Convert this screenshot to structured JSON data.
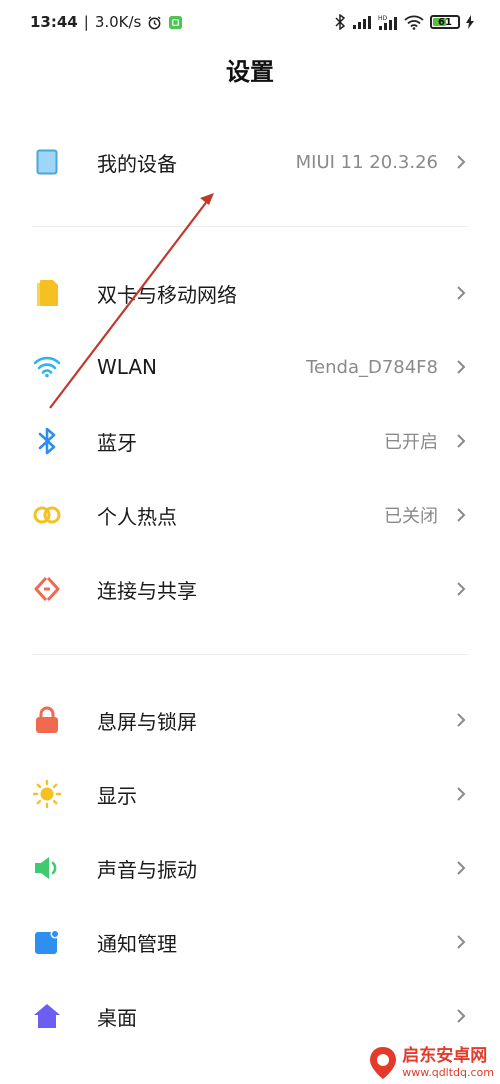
{
  "status_bar": {
    "time": "13:44",
    "separator": "|",
    "net_speed": "3.0K/s",
    "battery_level": "61",
    "battery_fraction": 0.61,
    "icons": [
      "alarm-icon",
      "app-notification-icon",
      "bluetooth-icon",
      "signal-icon",
      "hd-signal-icon",
      "wifi-icon",
      "battery-icon",
      "charging-icon"
    ]
  },
  "header": {
    "title": "设置"
  },
  "items": [
    {
      "id": "my-device",
      "label": "我的设备",
      "value": "MIUI 11 20.3.26",
      "icon": "phone-device-icon"
    },
    {
      "id": "dual-sim",
      "label": "双卡与移动网络",
      "value": "",
      "icon": "sim-card-icon"
    },
    {
      "id": "wlan",
      "label": "WLAN",
      "value": "Tenda_D784F8",
      "icon": "wifi-icon"
    },
    {
      "id": "bluetooth",
      "label": "蓝牙",
      "value": "已开启",
      "icon": "bluetooth-icon"
    },
    {
      "id": "hotspot",
      "label": "个人热点",
      "value": "已关闭",
      "icon": "hotspot-icon"
    },
    {
      "id": "connection-sharing",
      "label": "连接与共享",
      "value": "",
      "icon": "share-icon"
    },
    {
      "id": "lock-screen",
      "label": "息屏与锁屏",
      "value": "",
      "icon": "lock-icon"
    },
    {
      "id": "display",
      "label": "显示",
      "value": "",
      "icon": "sun-icon"
    },
    {
      "id": "sound",
      "label": "声音与振动",
      "value": "",
      "icon": "speaker-icon"
    },
    {
      "id": "notifications",
      "label": "通知管理",
      "value": "",
      "icon": "notification-icon"
    },
    {
      "id": "desktop",
      "label": "桌面",
      "value": "",
      "icon": "home-icon"
    }
  ],
  "colors": {
    "sim": "#f5c021",
    "wifi": "#2eb3f0",
    "bluetooth": "#2e8ff0",
    "hotspot": "#f5c021",
    "share": "#f06a4f",
    "lock": "#f06a4f",
    "sun": "#f5c021",
    "speaker": "#3ecb6f",
    "notification": "#2e8ff0",
    "home": "#6c5ef2",
    "annotation_arrow": "#c0392b"
  },
  "watermark": {
    "brand_cn": "启东安卓网",
    "brand_url": "www.qdltdq.com"
  }
}
